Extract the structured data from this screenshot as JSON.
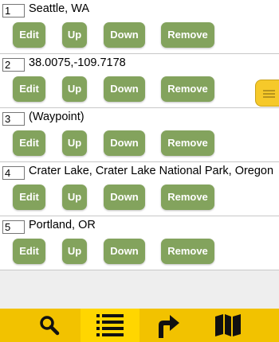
{
  "waypoints": [
    {
      "number": "1",
      "name": "Seattle, WA"
    },
    {
      "number": "2",
      "name": "38.0075,-109.7178"
    },
    {
      "number": "3",
      "name": "(Waypoint)"
    },
    {
      "number": "4",
      "name": "Crater Lake, Crater Lake National Park, Oregon"
    },
    {
      "number": "5",
      "name": "Portland, OR"
    }
  ],
  "buttons": {
    "edit": "Edit",
    "up": "Up",
    "down": "Down",
    "remove": "Remove"
  },
  "bottom_nav": [
    {
      "icon": "search-icon",
      "active": false
    },
    {
      "icon": "list-icon",
      "active": true
    },
    {
      "icon": "directions-icon",
      "active": false
    },
    {
      "icon": "map-icon",
      "active": false
    }
  ],
  "colors": {
    "button_green": "#83a35d",
    "toolbar_yellow": "#f2c200",
    "active_tab_yellow": "#ffd600",
    "side_tab_yellow": "#f6c92a"
  }
}
